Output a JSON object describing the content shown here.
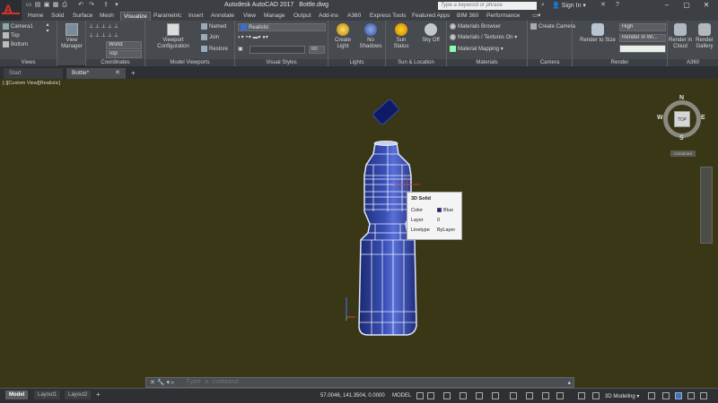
{
  "titlebar": {
    "app_name": "Autodesk AutoCAD 2017",
    "file_name": "Bottle.dwg",
    "search_placeholder": "Type a keyword or phrase",
    "sign_in": "Sign In"
  },
  "ribbon_tabs": [
    "Home",
    "Solid",
    "Surface",
    "Mesh",
    "Visualize",
    "Parametric",
    "Insert",
    "Annotate",
    "View",
    "Manage",
    "Output",
    "Add-ins",
    "A360",
    "Express Tools",
    "Featured Apps",
    "BIM 360",
    "Performance"
  ],
  "active_tab": "Visualize",
  "panels": {
    "views": {
      "title": "Views",
      "items": [
        "Camera1",
        "Top",
        "Bottom"
      ]
    },
    "view_manager": {
      "label1": "View",
      "label2": "Manager"
    },
    "coordinates": {
      "title": "Coordinates",
      "world": "World",
      "top": "Top"
    },
    "model_viewports": {
      "title": "Model Viewports",
      "config1": "Viewport",
      "config2": "Configuration",
      "named": "Named",
      "join": "Join",
      "restore": "Restore"
    },
    "visual_styles": {
      "title": "Visual Styles",
      "style": "Realistic",
      "opacity": "00"
    },
    "lights": {
      "title": "Lights",
      "create1": "Create",
      "create2": "Light",
      "shadows1": "No",
      "shadows2": "Shadows"
    },
    "sun": {
      "title": "Sun & Location",
      "sun1": "Sun",
      "sun2": "Status",
      "sky1": "Sky Off"
    },
    "materials": {
      "title": "Materials",
      "browser": "Materials Browser",
      "textures": "Materials / Textures On",
      "mapping": "Material Mapping"
    },
    "camera": {
      "title": "Camera",
      "create": "Create Camera"
    },
    "render": {
      "title": "Render",
      "quality": "High",
      "render_in": "Render in Wi...",
      "render_size1": "Render to Size"
    },
    "a360": {
      "title": "A360",
      "cloud1": "Render in",
      "cloud2": "Cloud",
      "gallery1": "Render",
      "gallery2": "Gallery"
    }
  },
  "file_tabs": [
    "Start",
    "Bottle*"
  ],
  "viewport": {
    "label": "[-][Custom View][Realistic]",
    "viewcube": {
      "top": "TOP",
      "n": "N",
      "s": "S",
      "e": "E",
      "w": "W",
      "wcs": "Unnamed"
    }
  },
  "tooltip": {
    "title": "3D Solid",
    "rows": [
      {
        "key": "Color",
        "value": "Blue"
      },
      {
        "key": "Layer",
        "value": "0"
      },
      {
        "key": "Linetype",
        "value": "ByLayer"
      }
    ]
  },
  "command": {
    "placeholder": "Type a command"
  },
  "status": {
    "layout_tabs": [
      "Model",
      "Layout1",
      "Layout2"
    ],
    "coords": "57.0046, 141.3504, 0.0000",
    "mode": "MODEL",
    "workspace": "3D Modeling"
  },
  "colors": {
    "viewport_bg": "#3a3716",
    "bottle_blue": "#2a3a9a",
    "cap": "#101c6a"
  }
}
